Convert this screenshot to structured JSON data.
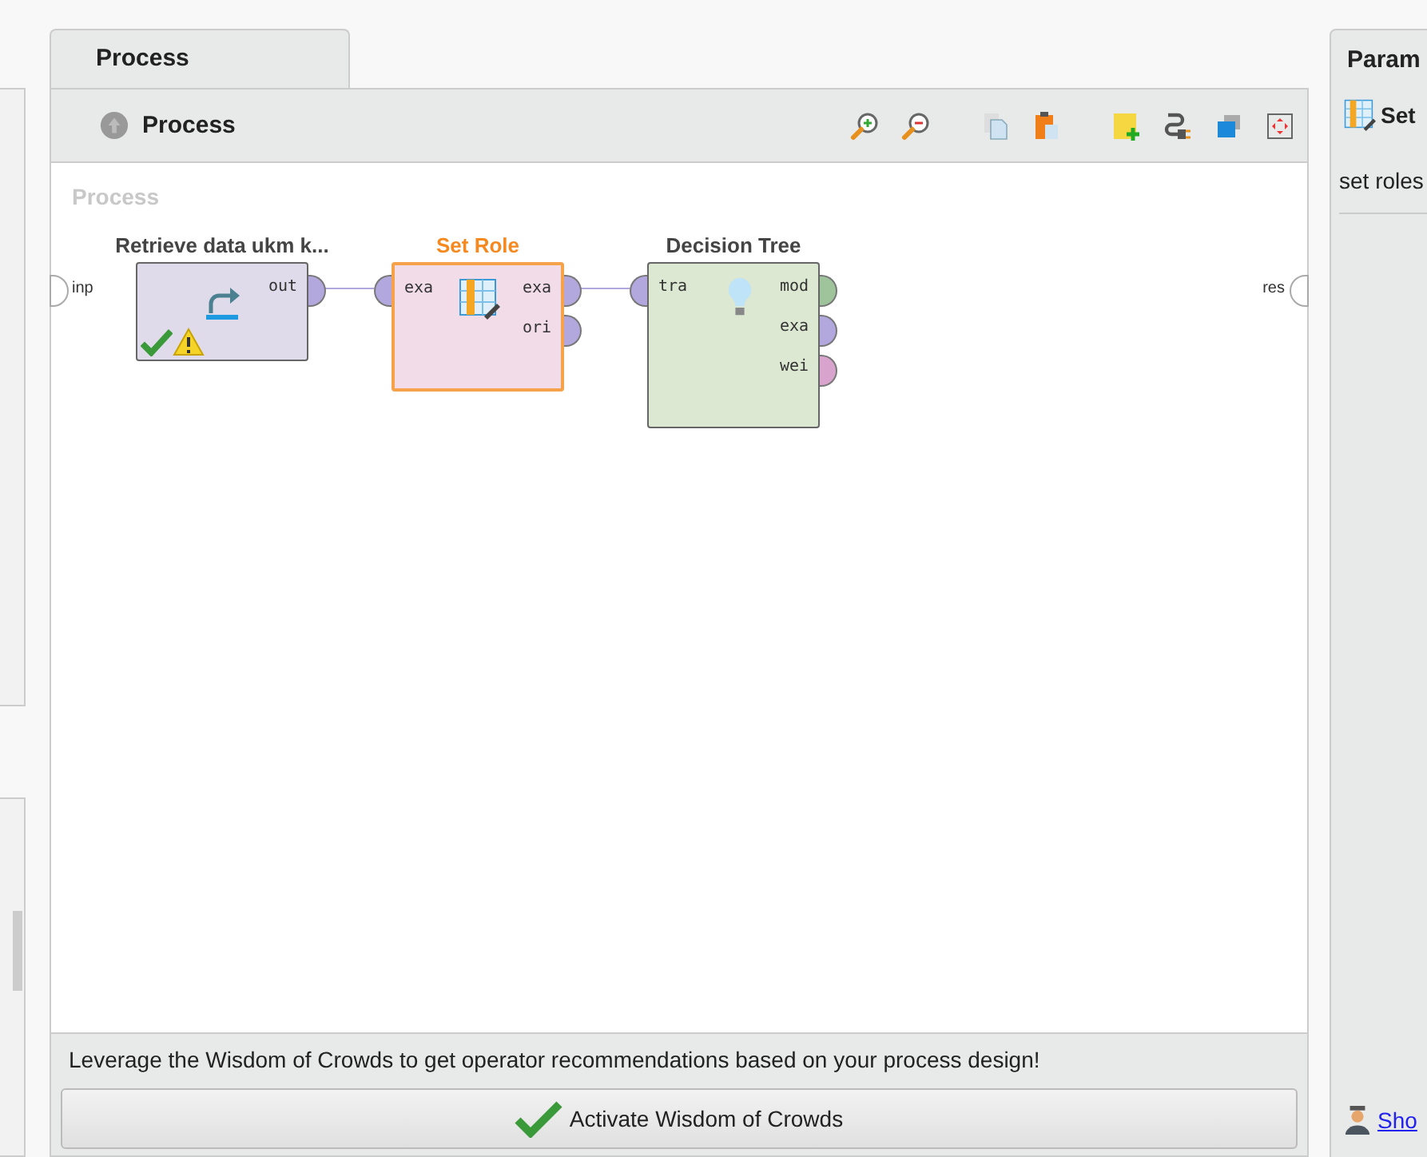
{
  "tabs": [
    {
      "label": "Process",
      "selected": true
    }
  ],
  "breadcrumb": "Process",
  "canvas": {
    "title": "Process",
    "input_port": "inp",
    "output_port": "res",
    "operators": [
      {
        "name": "Retrieve data ukm k...",
        "kind": "retrieve",
        "selected": false,
        "color": "#dfdbea",
        "ok": true,
        "warning": true,
        "outputs": [
          {
            "label": "out",
            "color": "#b3a8dd"
          }
        ]
      },
      {
        "name": "Set Role",
        "kind": "set_role",
        "selected": true,
        "color": "#f2dce8",
        "ok": false,
        "warning": false,
        "inputs": [
          {
            "label": "exa",
            "color": "#b3a8dd"
          }
        ],
        "outputs": [
          {
            "label": "exa",
            "color": "#b3a8dd"
          },
          {
            "label": "ori",
            "color": "#b3a8dd"
          }
        ]
      },
      {
        "name": "Decision Tree",
        "kind": "tree",
        "selected": false,
        "color": "#dce8d2",
        "ok": false,
        "warning": false,
        "inputs": [
          {
            "label": "tra",
            "color": "#b3a8dd"
          }
        ],
        "outputs": [
          {
            "label": "mod",
            "color": "#9fc49c"
          },
          {
            "label": "exa",
            "color": "#b3a8dd"
          },
          {
            "label": "wei",
            "color": "#d8a3cd"
          }
        ]
      }
    ]
  },
  "wisdom": {
    "message": "Leverage the Wisdom of Crowds to get operator recommendations based on your process design!",
    "button": "Activate Wisdom of Crowds"
  },
  "parameters": {
    "title": "Param",
    "operator": "Set",
    "description": "set roles",
    "link": "Sho"
  }
}
